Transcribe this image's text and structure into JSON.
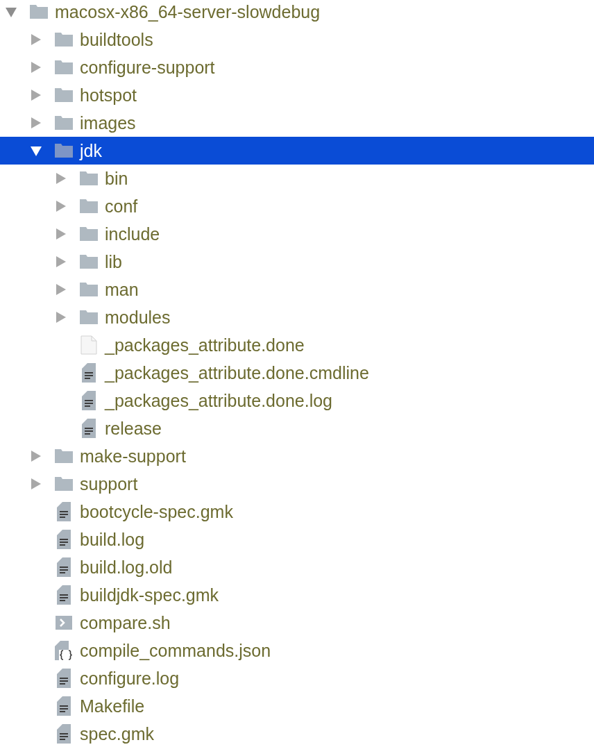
{
  "tree": [
    {
      "name": "macosx-x86_64-server-slowdebug",
      "kind": "folder",
      "expanded": true,
      "selected": false,
      "children": [
        {
          "name": "buildtools",
          "kind": "folder",
          "expanded": false,
          "selected": false
        },
        {
          "name": "configure-support",
          "kind": "folder",
          "expanded": false,
          "selected": false
        },
        {
          "name": "hotspot",
          "kind": "folder",
          "expanded": false,
          "selected": false
        },
        {
          "name": "images",
          "kind": "folder",
          "expanded": false,
          "selected": false
        },
        {
          "name": "jdk",
          "kind": "folder",
          "expanded": true,
          "selected": true,
          "children": [
            {
              "name": "bin",
              "kind": "folder",
              "expanded": false,
              "selected": false
            },
            {
              "name": "conf",
              "kind": "folder",
              "expanded": false,
              "selected": false
            },
            {
              "name": "include",
              "kind": "folder",
              "expanded": false,
              "selected": false
            },
            {
              "name": "lib",
              "kind": "folder",
              "expanded": false,
              "selected": false
            },
            {
              "name": "man",
              "kind": "folder",
              "expanded": false,
              "selected": false
            },
            {
              "name": "modules",
              "kind": "folder",
              "expanded": false,
              "selected": false
            },
            {
              "name": "_packages_attribute.done",
              "kind": "file",
              "selected": false
            },
            {
              "name": "_packages_attribute.done.cmdline",
              "kind": "text",
              "selected": false
            },
            {
              "name": "_packages_attribute.done.log",
              "kind": "text",
              "selected": false
            },
            {
              "name": "release",
              "kind": "text",
              "selected": false
            }
          ]
        },
        {
          "name": "make-support",
          "kind": "folder",
          "expanded": false,
          "selected": false
        },
        {
          "name": "support",
          "kind": "folder",
          "expanded": false,
          "selected": false
        },
        {
          "name": "bootcycle-spec.gmk",
          "kind": "text",
          "selected": false
        },
        {
          "name": "build.log",
          "kind": "text",
          "selected": false
        },
        {
          "name": "build.log.old",
          "kind": "text",
          "selected": false
        },
        {
          "name": "buildjdk-spec.gmk",
          "kind": "text",
          "selected": false
        },
        {
          "name": "compare.sh",
          "kind": "shell",
          "selected": false
        },
        {
          "name": "compile_commands.json",
          "kind": "json",
          "selected": false
        },
        {
          "name": "configure.log",
          "kind": "text",
          "selected": false
        },
        {
          "name": "Makefile",
          "kind": "text",
          "selected": false
        },
        {
          "name": "spec.gmk",
          "kind": "text",
          "selected": false
        }
      ]
    }
  ]
}
